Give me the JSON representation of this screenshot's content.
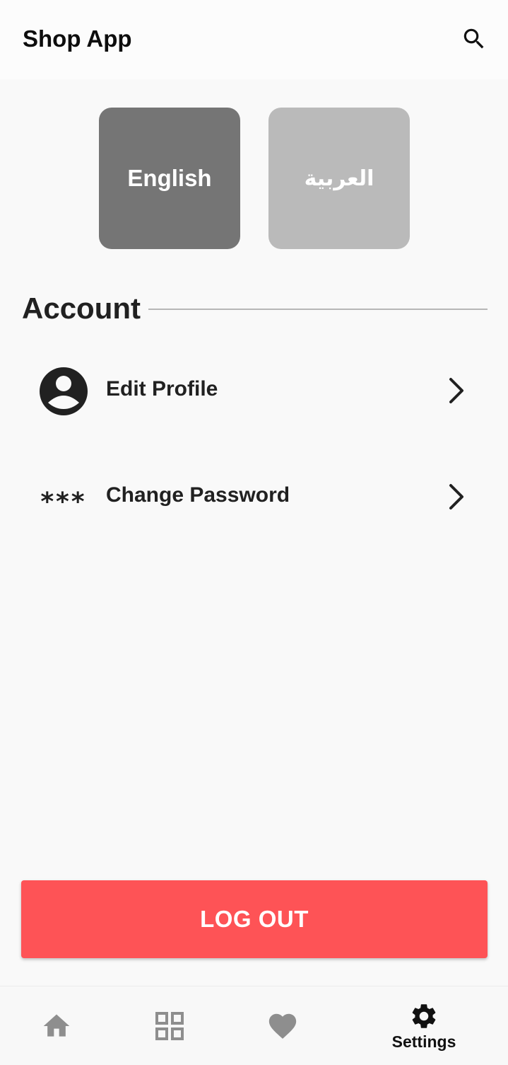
{
  "app_bar": {
    "title": "Shop App",
    "search_icon": "search-icon"
  },
  "language": {
    "english_label": "English",
    "arabic_label": "العربية",
    "selected": "English"
  },
  "account": {
    "section_title": "Account",
    "items": [
      {
        "label": "Edit Profile",
        "icon": "account-circle-icon"
      },
      {
        "label": "Change Password",
        "icon": "password-icon"
      }
    ]
  },
  "logout": {
    "label": "LOG OUT",
    "color": "#fe5356"
  },
  "bottom_nav": {
    "items": [
      {
        "icon": "home-icon",
        "label": ""
      },
      {
        "icon": "grid-icon",
        "label": ""
      },
      {
        "icon": "heart-icon",
        "label": ""
      },
      {
        "icon": "gear-icon",
        "label": "Settings"
      }
    ],
    "active": "Settings"
  }
}
